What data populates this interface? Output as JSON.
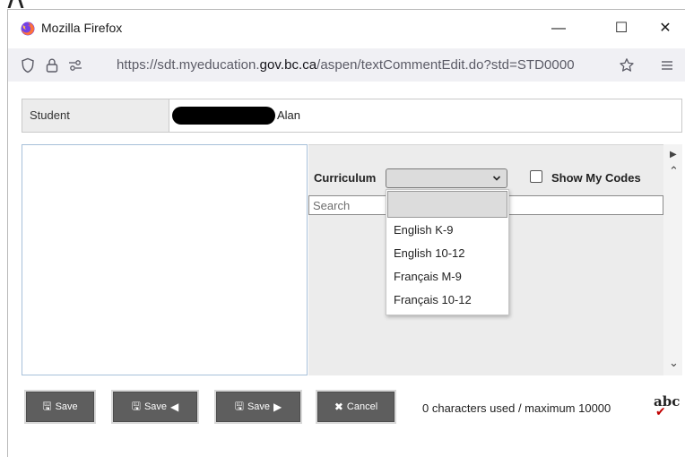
{
  "window": {
    "title": "Mozilla Firefox",
    "controls": {
      "minimize": "—",
      "maximize": "☐",
      "close": "✕"
    }
  },
  "urlbar": {
    "url_prefix": "https://sdt.myeducation.",
    "url_domain": "gov.bc.ca",
    "url_suffix": "/aspen/textCommentEdit.do?std=STD0000"
  },
  "student": {
    "label": "Student",
    "name": "Alan"
  },
  "filters": {
    "curriculum_label": "Curriculum",
    "curriculum_selected": "",
    "show_my_codes_label": "Show My Codes",
    "show_my_codes_checked": false,
    "search_placeholder": "Search"
  },
  "curriculum_options": [
    "",
    "English K-9",
    "English 10-12",
    "Français M-9",
    "Français 10-12"
  ],
  "buttons": {
    "save": "Save",
    "save_prev": "Save",
    "save_next": "Save",
    "cancel": "Cancel"
  },
  "status": {
    "char_count": "0 characters used / maximum 10000",
    "spellcheck": "abc"
  },
  "colors": {
    "button_bg": "#5e5e5e",
    "panel_bg": "#ececec",
    "editor_border": "#a7c0d9",
    "spellcheck_mark": "#c00000"
  }
}
